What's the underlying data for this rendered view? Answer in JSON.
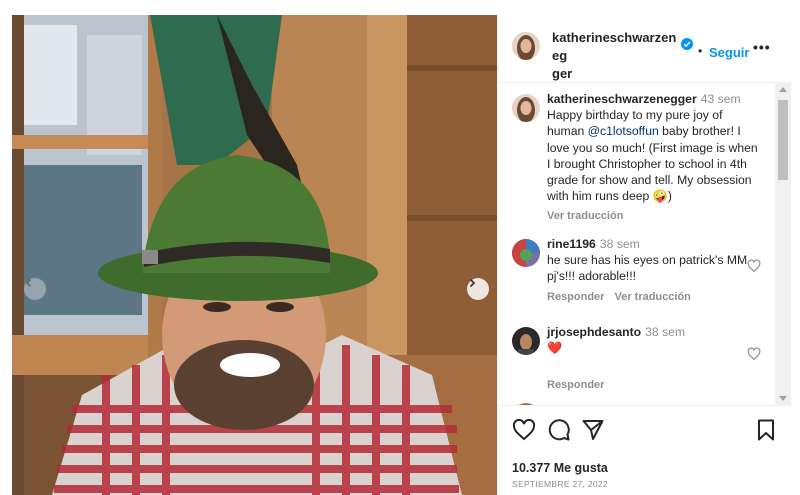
{
  "post": {
    "author": "katherineschwarzenegger",
    "author_wrapped": "katherineschwarzeneg\nger",
    "dot": "•",
    "follow_label": "Seguir",
    "more_label": "•••"
  },
  "comments": [
    {
      "user": "katherineschwarzenegger",
      "time": "43 sem",
      "text_before": "Happy birthday to my pure joy of human ",
      "mention": "@c1lotsoffun",
      "text_after": " baby brother! I love you so much! (First image is when I brought Christopher to school in 4th grade for show and tell. My obsession with him runs deep 🤪)",
      "see_translation": "Ver traducción"
    },
    {
      "user": "rine1196",
      "time": "38 sem",
      "text": "he sure has his eyes on patrick's MM pj's!!! adorable!!!",
      "reply": "Responder",
      "see_translation": "Ver traducción"
    },
    {
      "user": "jrjosephdesanto",
      "time": "38 sem",
      "text": "❤️",
      "reply": "Responder"
    }
  ],
  "actions": {
    "likes": "10.377 Me gusta",
    "date": "SEPTIEMBRE 27, 2022"
  },
  "icons": {
    "verified": "verified-badge-icon",
    "like": "heart-icon",
    "comment": "comment-icon",
    "share": "paper-plane-icon",
    "save": "bookmark-icon",
    "prev": "chevron-left-icon",
    "next": "chevron-right-icon"
  },
  "colors": {
    "link_blue": "#0095f6",
    "mention": "#00376b",
    "muted": "#8e8e8e",
    "heart_red": "#ed4956"
  }
}
